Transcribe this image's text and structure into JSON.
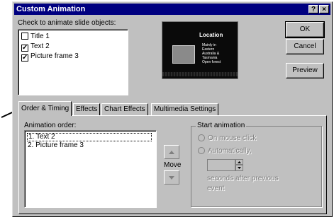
{
  "window": {
    "title": "Custom Animation",
    "help_label": "?",
    "close_label": "×"
  },
  "objects": {
    "label": "Check to animate slide objects:",
    "items": [
      {
        "label": "Title 1",
        "checked": false,
        "mark": ""
      },
      {
        "label": "Text 2",
        "checked": true,
        "mark": "✓"
      },
      {
        "label": "Picture frame 3",
        "checked": true,
        "mark": "✓"
      }
    ]
  },
  "slide_preview": {
    "title": "Location",
    "bullets": [
      "Mainly in",
      "Eastern",
      "Australia &",
      "Tasmania",
      "Open forest"
    ]
  },
  "buttons": {
    "ok": "OK",
    "cancel": "Cancel",
    "preview": "Preview"
  },
  "tabs": [
    "Order & Timing",
    "Effects",
    "Chart Effects",
    "Multimedia Settings"
  ],
  "active_tab": "Order & Timing",
  "order": {
    "label": "Animation order:",
    "items": [
      "1. Text 2",
      "2. Picture frame 3"
    ],
    "move_label": "Move",
    "up_icon": "up-arrow-icon",
    "down_icon": "down-arrow-icon"
  },
  "start_animation": {
    "label": "Start animation",
    "on_mouse_click": "On mouse click",
    "automatically": "Automatically,",
    "seconds_line1": "seconds after previous",
    "seconds_line2": "event",
    "seconds_value": ""
  }
}
